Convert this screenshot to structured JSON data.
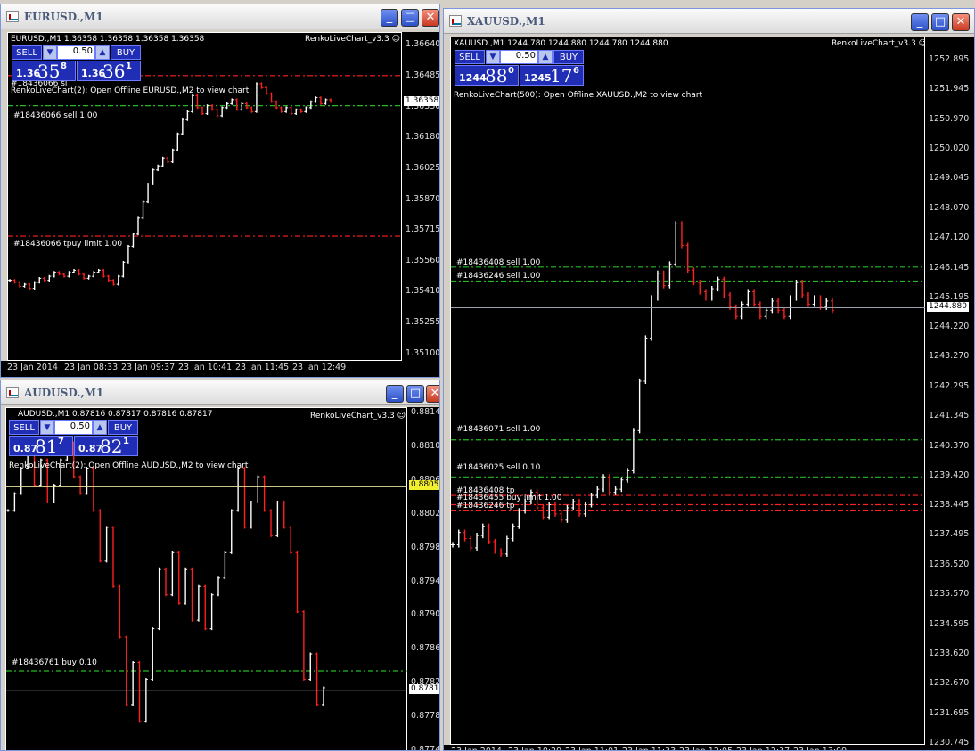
{
  "windows": [
    {
      "id": "eur",
      "title": "EURUSD.,M1",
      "info": "EURUSD.,M1  1.36358 1.36358 1.36358 1.36358",
      "indicator": "RenkoLiveChart_v3.3 ☺",
      "comment": "RenkoLiveChart(2): Open Offline EURUSD.,M2 to view chart",
      "panel": {
        "sell_label": "SELL",
        "buy_label": "BUY",
        "lot": "0.50",
        "spin_down": "▼",
        "spin_up": "▲",
        "sell_a": "1.36",
        "sell_b": "35",
        "sell_c": "8",
        "buy_a": "1.36",
        "buy_b": "36",
        "buy_c": "1"
      },
      "price_labels": [
        "1.36640",
        "1.36485",
        "1.36330",
        "1.36180",
        "1.36025",
        "1.35870",
        "1.35715",
        "1.35560",
        "1.35410",
        "1.35255",
        "1.35100"
      ],
      "time_labels": [
        "23 Jan 2014",
        "23 Jan 08:33",
        "23 Jan 09:37",
        "23 Jan 10:41",
        "23 Jan 11:45",
        "23 Jan 12:49"
      ],
      "current_price": "1.36358",
      "orders": [
        "#18436066 sl",
        "#18436066 sell 1.00",
        "#18436066 tp",
        "#18436066 tp",
        "#18436066 tp",
        "#18436066 tp"
      ],
      "order_label_sl": "#18436066 sl",
      "order_label_sell": "#18436066 sell 1.00",
      "order_label_tp": "#18436066 tpuy limit 1.00",
      "chart_data": {
        "type": "bar",
        "ylim": [
          1.351,
          1.3664
        ],
        "lines": [
          {
            "label": "#18436066 sl",
            "price": 1.3649,
            "color": "#ff2020"
          },
          {
            "label": "#18436066 sell 1.00",
            "price": 1.3634,
            "color": "#22bb22"
          },
          {
            "label": "#18436066 tpuy limit 1.00",
            "price": 1.3569,
            "color": "#ff2020"
          }
        ],
        "series": [
          1.3547,
          1.3546,
          1.3544,
          1.3545,
          1.3543,
          1.3546,
          1.3548,
          1.3547,
          1.3549,
          1.3551,
          1.355,
          1.3549,
          1.3551,
          1.3552,
          1.355,
          1.3548,
          1.3549,
          1.3551,
          1.3552,
          1.3549,
          1.3547,
          1.3545,
          1.3549,
          1.3556,
          1.3564,
          1.357,
          1.3578,
          1.3586,
          1.3595,
          1.3602,
          1.3604,
          1.3608,
          1.3606,
          1.3612,
          1.362,
          1.3627,
          1.3631,
          1.3639,
          1.3633,
          1.363,
          1.3634,
          1.3632,
          1.3629,
          1.3633,
          1.3635,
          1.3637,
          1.3632,
          1.3635,
          1.3633,
          1.3631,
          1.3645,
          1.3643,
          1.364,
          1.3636,
          1.3633,
          1.3631,
          1.3633,
          1.363,
          1.3632,
          1.3631,
          1.3633,
          1.3636,
          1.3638,
          1.3635,
          1.3637,
          1.3636
        ]
      }
    },
    {
      "id": "aud",
      "title": "AUDUSD.,M1",
      "info": "AUDUSD.,M1  0.87816 0.87817 0.87816 0.87817",
      "indicator": "RenkoLiveChart_v3.3 ☺",
      "comment": "RenkoLiveChart(2): Open Offline AUDUSD.,M2 to view chart",
      "panel": {
        "sell_label": "SELL",
        "buy_label": "BUY",
        "lot": "0.50",
        "spin_down": "▼",
        "spin_up": "▲",
        "sell_a": "0.87",
        "sell_b": "81",
        "sell_c": "7",
        "buy_a": "0.87",
        "buy_b": "82",
        "buy_c": "1"
      },
      "price_labels": [
        "0.88145",
        "0.88105",
        "0.88065",
        "0.88025",
        "0.87985",
        "0.87945",
        "0.87905",
        "0.87865",
        "0.87825",
        "0.87785",
        "0.87745"
      ],
      "time_labels": [],
      "current_price": "0.87817",
      "highlight_price": "0.88058",
      "order_label_buy": "#18436761 buy 0.10",
      "chart_data": {
        "type": "bar",
        "ylim": [
          0.87745,
          0.88145
        ],
        "lines": [
          {
            "label": "#18436761 buy 0.10",
            "price": 0.8784,
            "color": "#22bb22"
          }
        ],
        "series": [
          0.8803,
          0.8805,
          0.8808,
          0.881,
          0.8806,
          0.8809,
          0.8804,
          0.8806,
          0.8809,
          0.8811,
          0.8807,
          0.8805,
          0.8808,
          0.8803,
          0.8797,
          0.8801,
          0.8794,
          0.8788,
          0.878,
          0.8785,
          0.8778,
          0.8783,
          0.8789,
          0.8796,
          0.8793,
          0.8798,
          0.8792,
          0.8796,
          0.879,
          0.8794,
          0.8789,
          0.8793,
          0.8795,
          0.8798,
          0.8803,
          0.8808,
          0.8801,
          0.8804,
          0.8807,
          0.8803,
          0.88,
          0.8804,
          0.8801,
          0.8798,
          0.8791,
          0.8783,
          0.8786,
          0.878,
          0.8782
        ]
      }
    },
    {
      "id": "xau",
      "title": "XAUUSD.,M1",
      "info": "XAUUSD.,M1  1244.780 1244.880 1244.780 1244.880",
      "indicator": "RenkoLiveChart_v3.3 ☺",
      "comment": "RenkoLiveChart(500): Open Offline XAUUSD.,M2 to view chart",
      "panel": {
        "sell_label": "SELL",
        "buy_label": "BUY",
        "lot": "0.50",
        "spin_down": "▼",
        "spin_up": "▲",
        "sell_a": "1244",
        "sell_b": "88",
        "sell_c": "0",
        "buy_a": "1245",
        "buy_b": "17",
        "buy_c": "6"
      },
      "price_labels": [
        "1252.895",
        "1251.945",
        "1250.970",
        "1250.020",
        "1249.045",
        "1248.070",
        "1247.120",
        "1246.145",
        "1245.195",
        "1244.220",
        "1243.270",
        "1242.295",
        "1241.345",
        "1240.370",
        "1239.420",
        "1238.445",
        "1237.495",
        "1236.520",
        "1235.570",
        "1234.595",
        "1233.620",
        "1232.670",
        "1231.695",
        "1230.745"
      ],
      "time_labels": [
        "23 Jan 2014",
        "23 Jan 10:29",
        "23 Jan 11:01",
        "23 Jan 11:33",
        "23 Jan 12:05",
        "23 Jan 12:37",
        "23 Jan 13:09"
      ],
      "current_price": "1244.880",
      "order_label_1": "#18436408 sell 1.00",
      "order_label_2": "#18436246 sell 1.00",
      "order_label_3": "#18436071 sell 1.00",
      "order_label_4": "#18436025 sell 0.10",
      "order_label_5": "#18436408 tp",
      "order_label_6": "#18436455 buy limit 1.00",
      "order_label_7": "#18436246 tp",
      "chart_data": {
        "type": "bar",
        "ylim": [
          1230.745,
          1252.895
        ],
        "lines": [
          {
            "label": "#18436408 sell 1.00",
            "price": 1246.2,
            "color": "#22bb22"
          },
          {
            "label": "#18436246 sell 1.00",
            "price": 1245.75,
            "color": "#22bb22"
          },
          {
            "label": "#18436071 sell 1.00",
            "price": 1240.6,
            "color": "#22bb22"
          },
          {
            "label": "#18436025 sell 0.10",
            "price": 1239.4,
            "color": "#22bb22"
          },
          {
            "label": "#18436408 tp",
            "price": 1238.8,
            "color": "#ff2020"
          },
          {
            "label": "#18436455 buy limit 1.00",
            "price": 1238.5,
            "color": "#ff2020"
          },
          {
            "label": "#18436246 tp",
            "price": 1238.3,
            "color": "#ff2020"
          }
        ],
        "series": [
          1237.2,
          1237.6,
          1237.4,
          1237.1,
          1237.5,
          1237.8,
          1237.3,
          1237.0,
          1236.9,
          1237.4,
          1237.8,
          1238.3,
          1238.6,
          1238.9,
          1238.4,
          1238.1,
          1238.5,
          1238.2,
          1238.0,
          1238.4,
          1238.6,
          1238.2,
          1238.5,
          1238.8,
          1239.0,
          1239.4,
          1238.9,
          1239.0,
          1239.3,
          1239.6,
          1240.9,
          1242.5,
          1243.9,
          1245.2,
          1246.0,
          1245.6,
          1246.3,
          1247.6,
          1246.9,
          1246.1,
          1245.7,
          1245.4,
          1245.2,
          1245.5,
          1245.8,
          1245.3,
          1244.9,
          1244.6,
          1245.0,
          1245.4,
          1245.0,
          1244.6,
          1244.8,
          1245.1,
          1244.8,
          1244.6,
          1245.2,
          1245.7,
          1245.3,
          1245.0,
          1245.2,
          1244.9,
          1245.1,
          1244.8
        ]
      }
    }
  ]
}
